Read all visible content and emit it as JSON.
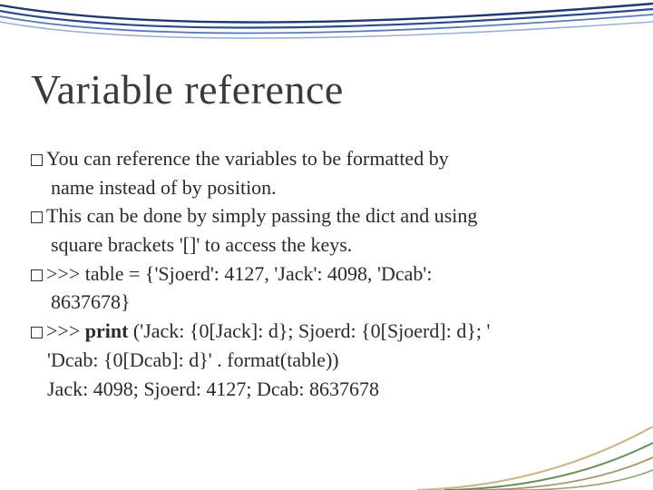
{
  "slide": {
    "title": "Variable reference",
    "bullets": {
      "b1": "You can reference the variables to be formatted by",
      "b1c": "name instead of by position.",
      "b2": "This can be done by simply passing the dict and using",
      "b2c": "square brackets '[]' to access the keys.",
      "b3": ">>> table = {'Sjoerd': 4127, 'Jack': 4098, 'Dcab':",
      "b3c": "8637678}",
      "b4a": ">>> ",
      "b4print": "print",
      "b4b": " ('Jack: {0[Jack]: d}; Sjoerd: {0[Sjoerd]: d}; '",
      "b4c": "'Dcab: {0[Dcab]: d}' . format(table))",
      "out": "Jack: 4098; Sjoerd: 4127; Dcab: 8637678"
    }
  }
}
